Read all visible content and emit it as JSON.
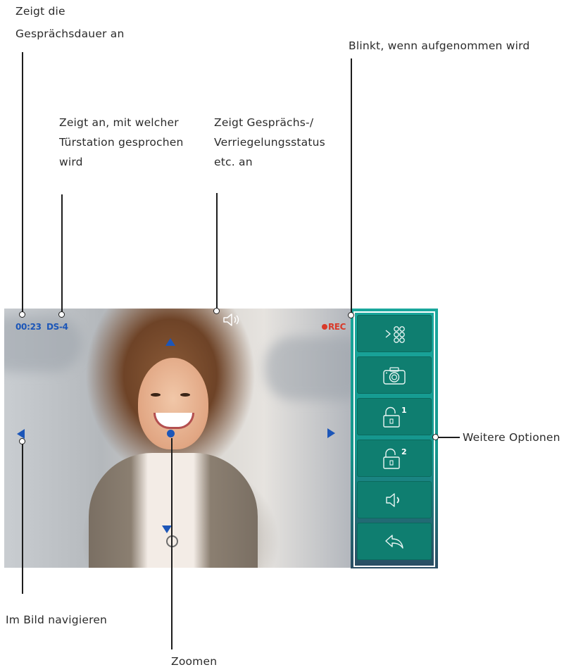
{
  "annotations": {
    "duration": [
      "Zeigt die",
      "Gesprächsdauer an"
    ],
    "station": [
      "Zeigt an, mit welcher",
      "Türstation gesprochen",
      "wird"
    ],
    "status": [
      "Zeigt Gesprächs-/",
      "Verriegelungsstatus",
      "etc. an"
    ],
    "recording": "Blinkt, wenn aufgenommen wird",
    "options": "Weitere Optionen",
    "navigate": "Im Bild navigieren",
    "zoom": "Zoomen"
  },
  "screen": {
    "call_time": "00:23",
    "station_id": "DS-4",
    "rec_label": "REC",
    "status_icon": "speaker-icon"
  },
  "options_menu": [
    {
      "icon": "door-stations-icon"
    },
    {
      "icon": "camera-icon"
    },
    {
      "icon": "unlock-1-icon",
      "index": "1"
    },
    {
      "icon": "unlock-2-icon",
      "index": "2"
    },
    {
      "icon": "speaker-icon"
    },
    {
      "icon": "back-icon"
    }
  ],
  "colors": {
    "osd_blue": "#1c56b8",
    "rec_red": "#d93a2a",
    "panel_teal": "#19a79c",
    "button_teal": "#0f7e70"
  }
}
